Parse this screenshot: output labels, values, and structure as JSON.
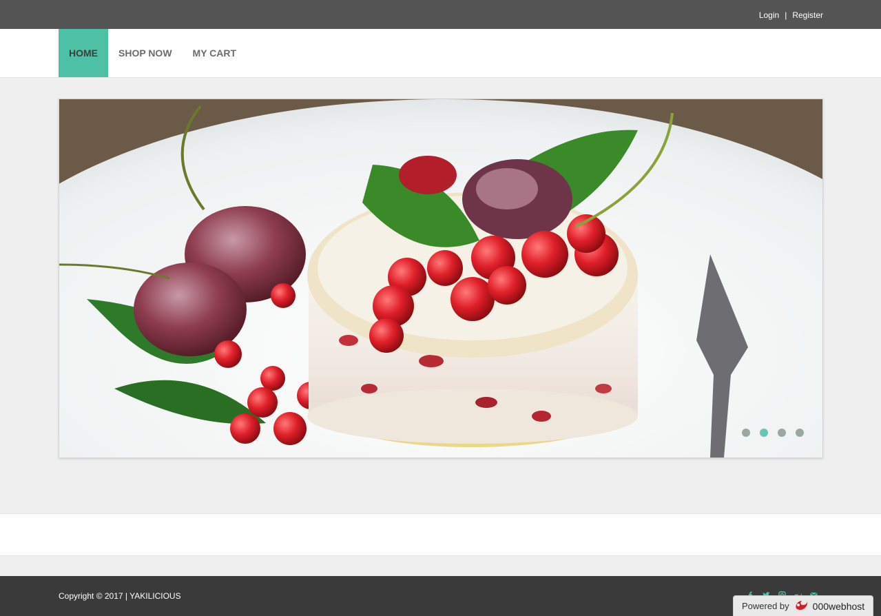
{
  "topbar": {
    "login": "Login",
    "separator": "|",
    "register": "Register"
  },
  "nav": {
    "items": [
      "HOME",
      "SHOP NOW",
      "MY CART"
    ],
    "active": "HOME"
  },
  "slider": {
    "image_alt": "dessert",
    "slide_count": 4,
    "active_index": 1
  },
  "footer": {
    "copyright": "Copyright © 2017 | YAKILICIOUS",
    "social_icons": [
      "facebook-icon",
      "twitter-icon",
      "instagram-icon",
      "google-plus-icon",
      "email-icon"
    ]
  },
  "badge": {
    "powered_by": "Powered by",
    "brand": "000webhost"
  },
  "colors": {
    "accent": "#4ec0a6",
    "topbar": "#545454",
    "footer": "#3a3a3a"
  }
}
